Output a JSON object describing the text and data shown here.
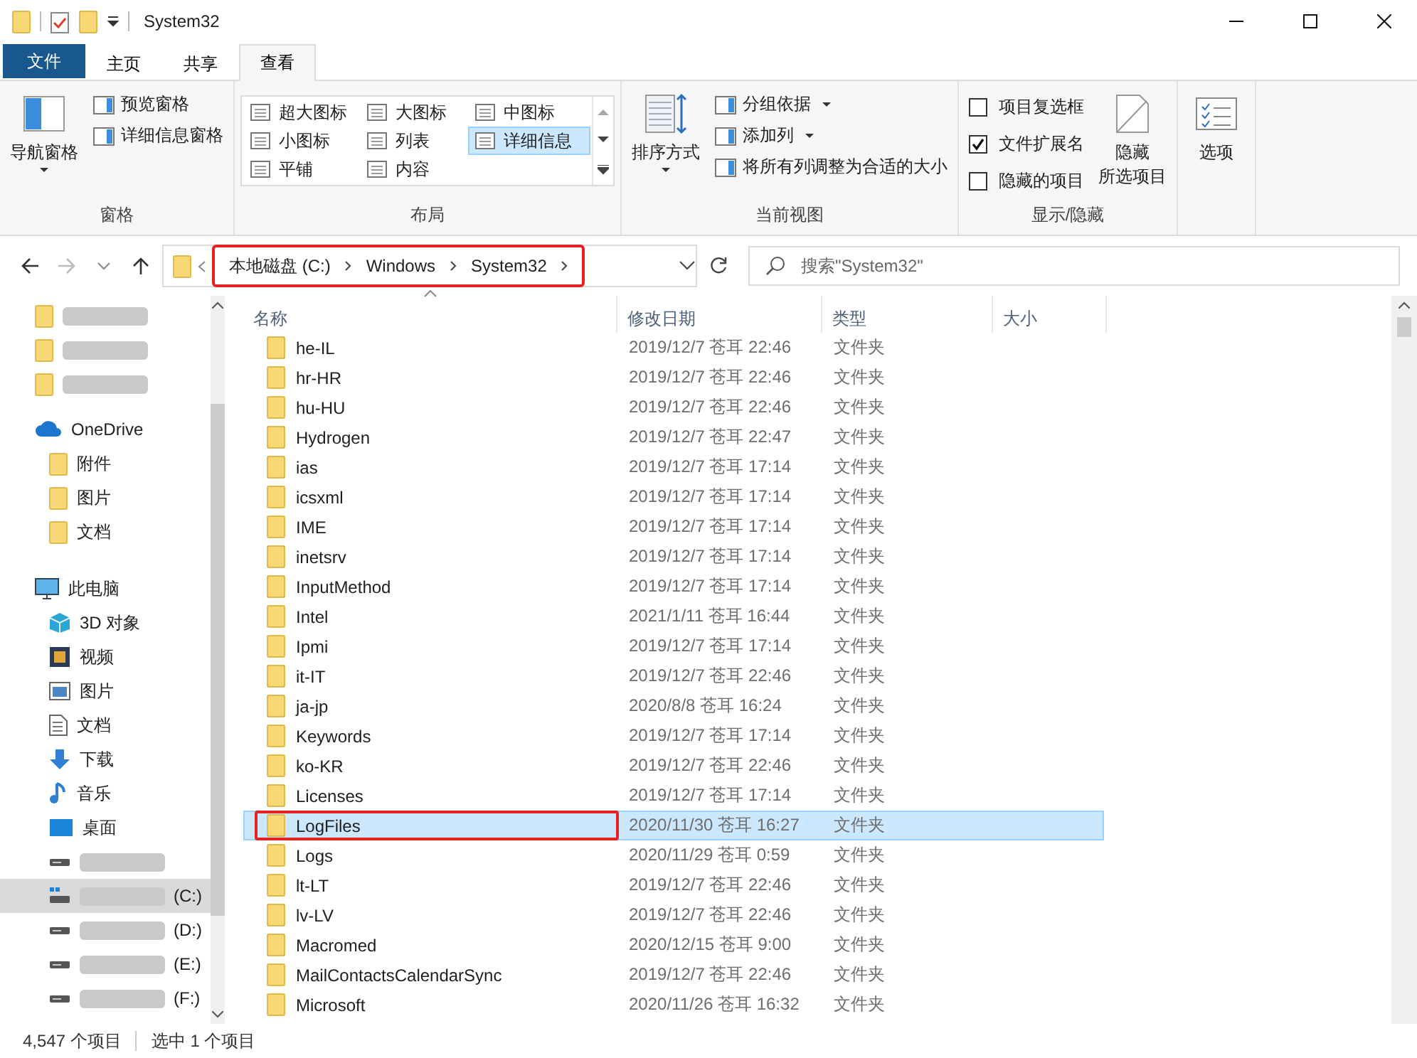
{
  "title_bar": {
    "title": "System32"
  },
  "ribbon_tabs": [
    {
      "label": "文件",
      "kind": "file",
      "selected": false
    },
    {
      "label": "主页",
      "kind": "tab",
      "selected": false
    },
    {
      "label": "共享",
      "kind": "tab",
      "selected": false
    },
    {
      "label": "查看",
      "kind": "tab",
      "selected": true
    }
  ],
  "ribbon_groups": [
    {
      "label": "窗格",
      "controls": [
        {
          "kind": "large",
          "lines": [
            "导航窗格"
          ],
          "dropdown": true
        },
        {
          "kind": "stack",
          "items": [
            {
              "kind": "small",
              "label": "预览窗格",
              "dropdown": false
            },
            {
              "kind": "small",
              "label": "详细信息窗格",
              "dropdown": false
            }
          ]
        }
      ]
    },
    {
      "label": "布局",
      "controls": [
        {
          "kind": "gallery",
          "options": [
            {
              "label": "超大图标",
              "selected": false
            },
            {
              "label": "大图标",
              "selected": false
            },
            {
              "label": "中图标",
              "selected": false
            },
            {
              "label": "小图标",
              "selected": false
            },
            {
              "label": "列表",
              "selected": false
            },
            {
              "label": "详细信息",
              "selected": true
            },
            {
              "label": "平铺",
              "selected": false
            },
            {
              "label": "内容",
              "selected": false
            }
          ]
        }
      ]
    },
    {
      "label": "当前视图",
      "controls": [
        {
          "kind": "large",
          "lines": [
            "排序方式"
          ],
          "dropdown": true
        },
        {
          "kind": "stack",
          "items": [
            {
              "kind": "small",
              "label": "分组依据",
              "dropdown": true
            },
            {
              "kind": "small",
              "label": "添加列",
              "dropdown": true
            },
            {
              "kind": "small",
              "label": "将所有列调整为合适的大小",
              "dropdown": false
            }
          ]
        }
      ]
    },
    {
      "label": "显示/隐藏",
      "controls": [
        {
          "kind": "stack",
          "items": [
            {
              "kind": "checkbox",
              "label": "项目复选框",
              "checked": false
            },
            {
              "kind": "checkbox",
              "label": "文件扩展名",
              "checked": true
            },
            {
              "kind": "checkbox",
              "label": "隐藏的项目",
              "checked": false
            }
          ]
        },
        {
          "kind": "large",
          "lines": [
            "隐藏",
            "所选项目"
          ],
          "dropdown": false
        }
      ]
    },
    {
      "controls": [
        {
          "kind": "large",
          "lines": [
            "选项"
          ],
          "dropdown": false
        }
      ]
    }
  ],
  "address_bar": {
    "breadcrumbs": [
      "本地磁盘 (C:)",
      "Windows",
      "System32"
    ],
    "highlighted": true
  },
  "search": {
    "placeholder": "搜索\"System32\""
  },
  "sidebar": {
    "items": [
      {
        "kind": "folder",
        "redacted": true,
        "selected": false
      },
      {
        "kind": "folder",
        "redacted": true,
        "selected": false
      },
      {
        "kind": "folder",
        "redacted": true,
        "selected": false
      },
      {
        "kind": "cloud",
        "label": "OneDrive",
        "selected": false,
        "children": [
          {
            "kind": "folder",
            "label": "附件",
            "selected": false
          },
          {
            "kind": "folder",
            "label": "图片",
            "selected": false
          },
          {
            "kind": "folder",
            "label": "文档",
            "selected": false
          }
        ]
      },
      {
        "kind": "pc",
        "label": "此电脑",
        "selected": false,
        "children": [
          {
            "kind": "cube",
            "label": "3D 对象",
            "selected": false
          },
          {
            "kind": "video",
            "label": "视频",
            "selected": false
          },
          {
            "kind": "picture",
            "label": "图片",
            "selected": false
          },
          {
            "kind": "document",
            "label": "文档",
            "selected": false
          },
          {
            "kind": "download",
            "label": "下载",
            "selected": false
          },
          {
            "kind": "music",
            "label": "音乐",
            "selected": false
          },
          {
            "kind": "desktop",
            "label": "桌面",
            "selected": false
          },
          {
            "kind": "drive",
            "redacted": true,
            "selected": false
          },
          {
            "kind": "system-drive",
            "redacted": true,
            "label": "(C:)",
            "selected": true
          },
          {
            "kind": "drive",
            "redacted": true,
            "label": "(D:)",
            "selected": false
          },
          {
            "kind": "drive",
            "redacted": true,
            "label": "(E:)",
            "selected": false
          },
          {
            "kind": "drive",
            "redacted": true,
            "label": "(F:)",
            "selected": false
          }
        ]
      }
    ]
  },
  "table": {
    "columns": [
      {
        "label": "名称",
        "sorted": true
      },
      {
        "label": "修改日期",
        "sorted": false
      },
      {
        "label": "类型",
        "sorted": false
      },
      {
        "label": "大小",
        "sorted": false
      }
    ],
    "rows": [
      {
        "name": "he-IL",
        "modified": "2019/12/7 苍耳 22:46",
        "type": "文件夹",
        "selected": false,
        "highlighted": false
      },
      {
        "name": "hr-HR",
        "modified": "2019/12/7 苍耳 22:46",
        "type": "文件夹",
        "selected": false,
        "highlighted": false
      },
      {
        "name": "hu-HU",
        "modified": "2019/12/7 苍耳 22:46",
        "type": "文件夹",
        "selected": false,
        "highlighted": false
      },
      {
        "name": "Hydrogen",
        "modified": "2019/12/7 苍耳 22:47",
        "type": "文件夹",
        "selected": false,
        "highlighted": false
      },
      {
        "name": "ias",
        "modified": "2019/12/7 苍耳 17:14",
        "type": "文件夹",
        "selected": false,
        "highlighted": false
      },
      {
        "name": "icsxml",
        "modified": "2019/12/7 苍耳 17:14",
        "type": "文件夹",
        "selected": false,
        "highlighted": false
      },
      {
        "name": "IME",
        "modified": "2019/12/7 苍耳 17:14",
        "type": "文件夹",
        "selected": false,
        "highlighted": false
      },
      {
        "name": "inetsrv",
        "modified": "2019/12/7 苍耳 17:14",
        "type": "文件夹",
        "selected": false,
        "highlighted": false
      },
      {
        "name": "InputMethod",
        "modified": "2019/12/7 苍耳 17:14",
        "type": "文件夹",
        "selected": false,
        "highlighted": false
      },
      {
        "name": "Intel",
        "modified": "2021/1/11 苍耳 16:44",
        "type": "文件夹",
        "selected": false,
        "highlighted": false
      },
      {
        "name": "Ipmi",
        "modified": "2019/12/7 苍耳 17:14",
        "type": "文件夹",
        "selected": false,
        "highlighted": false
      },
      {
        "name": "it-IT",
        "modified": "2019/12/7 苍耳 22:46",
        "type": "文件夹",
        "selected": false,
        "highlighted": false
      },
      {
        "name": "ja-jp",
        "modified": "2020/8/8 苍耳 16:24",
        "type": "文件夹",
        "selected": false,
        "highlighted": false
      },
      {
        "name": "Keywords",
        "modified": "2019/12/7 苍耳 17:14",
        "type": "文件夹",
        "selected": false,
        "highlighted": false
      },
      {
        "name": "ko-KR",
        "modified": "2019/12/7 苍耳 22:46",
        "type": "文件夹",
        "selected": false,
        "highlighted": false
      },
      {
        "name": "Licenses",
        "modified": "2019/12/7 苍耳 17:14",
        "type": "文件夹",
        "selected": false,
        "highlighted": false
      },
      {
        "name": "LogFiles",
        "modified": "2020/11/30 苍耳 16:27",
        "type": "文件夹",
        "selected": true,
        "highlighted": true
      },
      {
        "name": "Logs",
        "modified": "2020/11/29 苍耳 0:59",
        "type": "文件夹",
        "selected": false,
        "highlighted": false
      },
      {
        "name": "lt-LT",
        "modified": "2019/12/7 苍耳 22:46",
        "type": "文件夹",
        "selected": false,
        "highlighted": false
      },
      {
        "name": "lv-LV",
        "modified": "2019/12/7 苍耳 22:46",
        "type": "文件夹",
        "selected": false,
        "highlighted": false
      },
      {
        "name": "Macromed",
        "modified": "2020/12/15 苍耳 9:00",
        "type": "文件夹",
        "selected": false,
        "highlighted": false
      },
      {
        "name": "MailContactsCalendarSync",
        "modified": "2019/12/7 苍耳 22:46",
        "type": "文件夹",
        "selected": false,
        "highlighted": false
      },
      {
        "name": "Microsoft",
        "modified": "2020/11/26 苍耳 16:32",
        "type": "文件夹",
        "selected": false,
        "highlighted": false
      }
    ]
  },
  "status_bar": {
    "item_count": "4,547 个项目",
    "selection": "选中 1 个项目"
  }
}
